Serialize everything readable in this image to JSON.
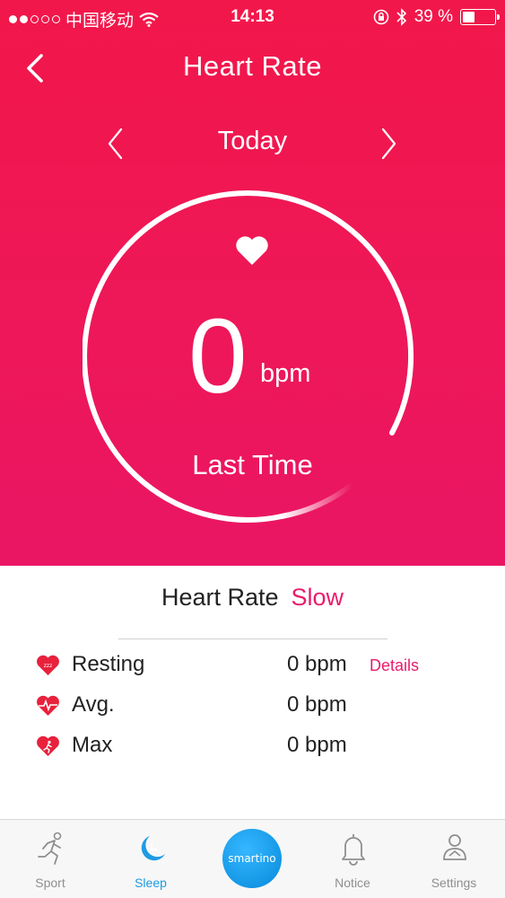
{
  "status_bar": {
    "carrier": "中国移动",
    "time": "14:13",
    "battery": "39 %",
    "battery_level": 0.39
  },
  "header": {
    "title": "Heart Rate"
  },
  "date_nav": {
    "label": "Today"
  },
  "reading": {
    "value": "0",
    "unit": "bpm",
    "caption": "Last Time"
  },
  "summary": {
    "title": "Heart Rate",
    "status": "Slow",
    "status_color": "#ea1c6a",
    "metrics": [
      {
        "label": "Resting",
        "value": "0 bpm",
        "link": "Details",
        "icon": "resting-heart-icon"
      },
      {
        "label": "Avg.",
        "value": "0 bpm",
        "icon": "pulse-heart-icon"
      },
      {
        "label": "Max",
        "value": "0 bpm",
        "icon": "running-heart-icon"
      }
    ]
  },
  "tabbar": {
    "tabs": [
      {
        "label": "Sport",
        "icon": "runner-icon"
      },
      {
        "label": "Sleep",
        "icon": "moon-icon",
        "active": true
      },
      {
        "label": "smartino",
        "icon": "brand-logo"
      },
      {
        "label": "Notice",
        "icon": "bell-icon"
      },
      {
        "label": "Settings",
        "icon": "person-icon"
      }
    ]
  },
  "colors": {
    "hero_top": "#f2174a",
    "hero_bottom": "#ea1664",
    "accent_blue": "#1e9be3"
  }
}
